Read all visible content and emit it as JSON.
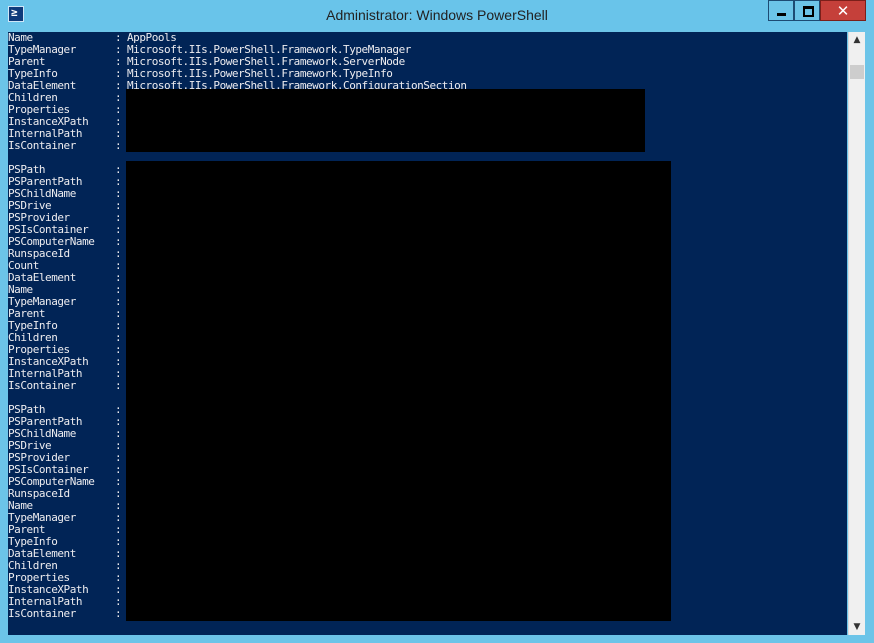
{
  "window": {
    "title": "Administrator: Windows PowerShell",
    "icon": "powershell-icon",
    "icon_glyph": "≥",
    "controls": {
      "minimize": "minimize-icon",
      "maximize": "maximize-icon",
      "close": "close-icon",
      "close_glyph": "✕"
    }
  },
  "colors": {
    "console_bg": "#012456",
    "console_text": "#eeedf0",
    "titlebar": "#69c4ea",
    "close": "#c5403a"
  },
  "console": {
    "lines": [
      {
        "key": "Name",
        "sep": ":",
        "value": "AppPools"
      },
      {
        "key": "TypeManager",
        "sep": ":",
        "value": "Microsoft.IIs.PowerShell.Framework.TypeManager"
      },
      {
        "key": "Parent",
        "sep": ":",
        "value": "Microsoft.IIs.PowerShell.Framework.ServerNode"
      },
      {
        "key": "TypeInfo",
        "sep": ":",
        "value": "Microsoft.IIs.PowerShell.Framework.TypeInfo"
      },
      {
        "key": "DataElement",
        "sep": ":",
        "value": "Microsoft.IIs.PowerShell.Framework.ConfigurationSection"
      },
      {
        "key": "Children",
        "sep": ":",
        "value": ""
      },
      {
        "key": "Properties",
        "sep": ":",
        "value": ""
      },
      {
        "key": "InstanceXPath",
        "sep": ":",
        "value": ""
      },
      {
        "key": "InternalPath",
        "sep": ":",
        "value": ""
      },
      {
        "key": "IsContainer",
        "sep": ":",
        "value": ""
      },
      {
        "key": "",
        "sep": "",
        "value": ""
      },
      {
        "key": "PSPath",
        "sep": ":",
        "value": ""
      },
      {
        "key": "PSParentPath",
        "sep": ":",
        "value": ""
      },
      {
        "key": "PSChildName",
        "sep": ":",
        "value": ""
      },
      {
        "key": "PSDrive",
        "sep": ":",
        "value": ""
      },
      {
        "key": "PSProvider",
        "sep": ":",
        "value": ""
      },
      {
        "key": "PSIsContainer",
        "sep": ":",
        "value": ""
      },
      {
        "key": "PSComputerName",
        "sep": ":",
        "value": ""
      },
      {
        "key": "RunspaceId",
        "sep": ":",
        "value": ""
      },
      {
        "key": "Count",
        "sep": ":",
        "value": ""
      },
      {
        "key": "DataElement",
        "sep": ":",
        "value": ""
      },
      {
        "key": "Name",
        "sep": ":",
        "value": ""
      },
      {
        "key": "TypeManager",
        "sep": ":",
        "value": ""
      },
      {
        "key": "Parent",
        "sep": ":",
        "value": ""
      },
      {
        "key": "TypeInfo",
        "sep": ":",
        "value": ""
      },
      {
        "key": "Children",
        "sep": ":",
        "value": ""
      },
      {
        "key": "Properties",
        "sep": ":",
        "value": ""
      },
      {
        "key": "InstanceXPath",
        "sep": ":",
        "value": ""
      },
      {
        "key": "InternalPath",
        "sep": ":",
        "value": ""
      },
      {
        "key": "IsContainer",
        "sep": ":",
        "value": ""
      },
      {
        "key": "",
        "sep": "",
        "value": ""
      },
      {
        "key": "PSPath",
        "sep": ":",
        "value": ""
      },
      {
        "key": "PSParentPath",
        "sep": ":",
        "value": ""
      },
      {
        "key": "PSChildName",
        "sep": ":",
        "value": ""
      },
      {
        "key": "PSDrive",
        "sep": ":",
        "value": ""
      },
      {
        "key": "PSProvider",
        "sep": ":",
        "value": ""
      },
      {
        "key": "PSIsContainer",
        "sep": ":",
        "value": ""
      },
      {
        "key": "PSComputerName",
        "sep": ":",
        "value": ""
      },
      {
        "key": "RunspaceId",
        "sep": ":",
        "value": ""
      },
      {
        "key": "Name",
        "sep": ":",
        "value": ""
      },
      {
        "key": "TypeManager",
        "sep": ":",
        "value": ""
      },
      {
        "key": "Parent",
        "sep": ":",
        "value": ""
      },
      {
        "key": "TypeInfo",
        "sep": ":",
        "value": ""
      },
      {
        "key": "DataElement",
        "sep": ":",
        "value": ""
      },
      {
        "key": "Children",
        "sep": ":",
        "value": ""
      },
      {
        "key": "Properties",
        "sep": ":",
        "value": ""
      },
      {
        "key": "InstanceXPath",
        "sep": ":",
        "value": ""
      },
      {
        "key": "InternalPath",
        "sep": ":",
        "value": ""
      },
      {
        "key": "IsContainer",
        "sep": ":",
        "value": ""
      }
    ]
  },
  "scrollbar": {
    "up_icon": "scroll-up-icon",
    "up_glyph": "▲",
    "down_icon": "scroll-down-icon",
    "down_glyph": "▼"
  }
}
